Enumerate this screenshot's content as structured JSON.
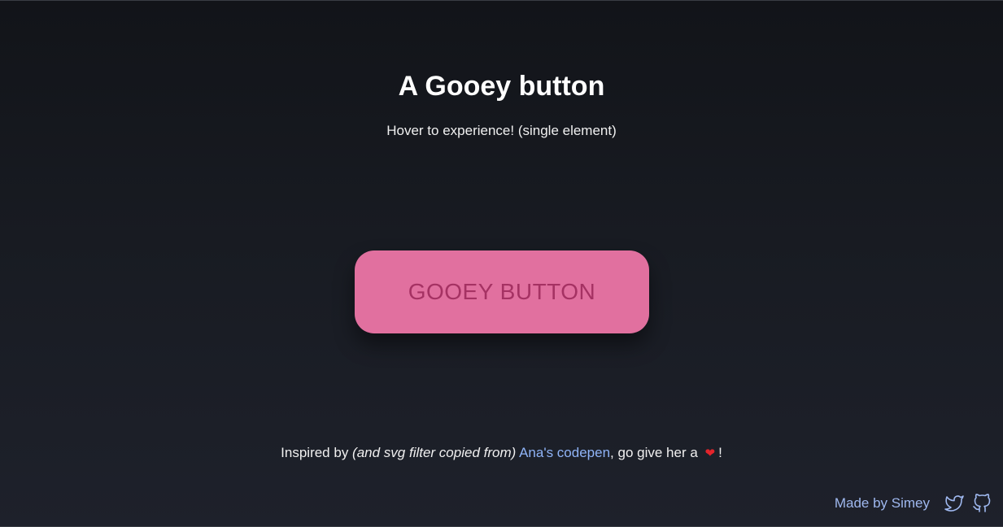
{
  "header": {
    "title": "A Gooey button",
    "subtitle": "Hover to experience! (single element)"
  },
  "main": {
    "button_label": "GOOEY BUTTON"
  },
  "credits": {
    "prefix": "Inspired by ",
    "italic_note": "(and svg filter copied from)",
    "link_text": "Ana's codepen",
    "middle": ", go give her a ",
    "heart": "❤",
    "suffix": "!"
  },
  "footer": {
    "made_by": "Made by Simey",
    "icons": [
      "twitter-icon",
      "github-icon"
    ]
  },
  "colors": {
    "button_bg": "#e1709f",
    "button_text": "#a53263",
    "link": "#8fb4f7",
    "footer_link": "#9fb8ef",
    "heart": "#e3242b"
  }
}
